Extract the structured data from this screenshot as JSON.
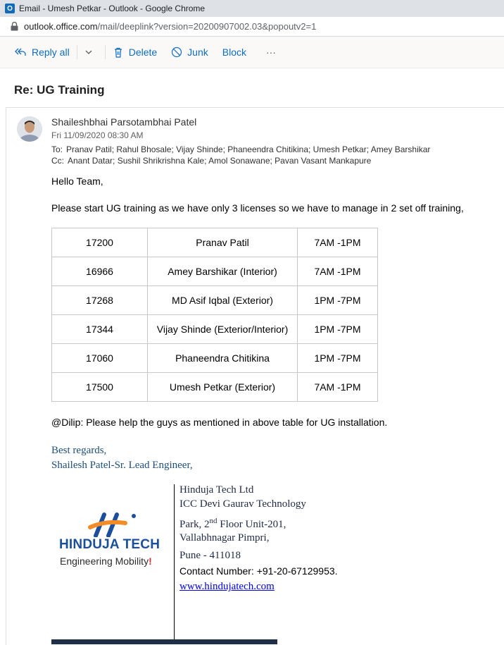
{
  "window": {
    "title": "Email - Umesh Petkar - Outlook - Google Chrome",
    "url_host": "outlook.office.com",
    "url_path": "/mail/deeplink?version=20200907002.03&popoutv2=1"
  },
  "toolbar": {
    "reply_all": "Reply all",
    "delete": "Delete",
    "junk": "Junk",
    "block": "Block",
    "more": "···"
  },
  "message": {
    "subject": "Re: UG Training",
    "sender": "Shaileshbhai Parsotambhai Patel",
    "date": "Fri 11/09/2020 08:30 AM",
    "to_label": "To:",
    "to": "Pranav Patil; Rahul Bhosale; Vijay Shinde; Phaneendra Chitikina; Umesh Petkar; Amey Barshikar",
    "cc_label": "Cc:",
    "cc": "Anant Datar; Sushil Shrikrishna Kale; Amol Sonawane; Pavan Vasant Mankapure",
    "greeting": "Hello Team,",
    "intro": "Please start UG training as we have only 3 licenses so we have to manage in 2 set off training,",
    "note": "@Dilip: Please help the guys as mentioned in above table for UG installation."
  },
  "schedule": [
    {
      "id": "17200",
      "name": "Pranav Patil",
      "time": "7AM -1PM"
    },
    {
      "id": "16966",
      "name": "Amey Barshikar (Interior)",
      "time": "7AM -1PM"
    },
    {
      "id": "17268",
      "name": "MD Asif Iqbal (Exterior)",
      "time": "1PM -7PM"
    },
    {
      "id": "17344",
      "name": "Vijay Shinde (Exterior/Interior)",
      "time": "1PM -7PM"
    },
    {
      "id": "17060",
      "name": "Phaneendra Chitikina",
      "time": "1PM -7PM"
    },
    {
      "id": "17500",
      "name": "Umesh Petkar (Exterior)",
      "time": "7AM -1PM"
    }
  ],
  "signature": {
    "regards": "Best regards,",
    "name_title": "Shailesh Patel-Sr. Lead Engineer,",
    "company": "Hinduja Tech Ltd",
    "addr1": "ICC Devi Gaurav Technology",
    "addr2_pre": "Park, 2",
    "addr2_sup": "nd",
    "addr2_post": " Floor Unit-201,",
    "addr3": "Vallabhnagar Pimpri,",
    "addr4": "Pune - 411018",
    "contact": "Contact Number: +91-20-67129953.",
    "website": "www.hindujatech.com",
    "logo_name": "HINDUJA TECH",
    "logo_tagline": "Engineering Mobility",
    "logo_bang": "!"
  },
  "colors": {
    "accent": "#0f6cbd",
    "signature_blue": "#1f4e79",
    "logo_blue": "#1b4f9c",
    "logo_orange": "#f28c28",
    "logo_red": "#e0282e"
  }
}
